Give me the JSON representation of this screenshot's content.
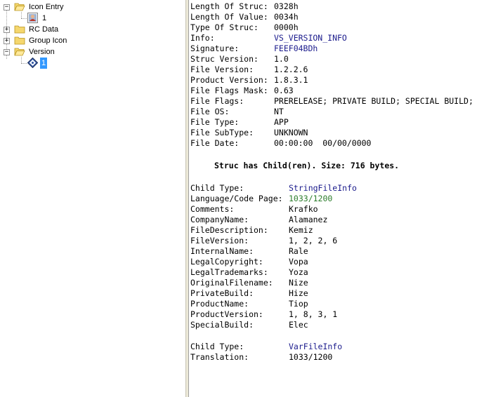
{
  "tree": {
    "items": [
      {
        "label": "Icon Entry",
        "expanded": true
      },
      {
        "label": "1"
      },
      {
        "label": "RC Data",
        "expanded": false
      },
      {
        "label": "Group Icon",
        "expanded": false
      },
      {
        "label": "Version",
        "expanded": true
      },
      {
        "label": "1",
        "selected": true
      }
    ]
  },
  "fixed_info": [
    {
      "key": "Length Of Struc:",
      "value": "0328h"
    },
    {
      "key": "Length Of Value:",
      "value": "0034h"
    },
    {
      "key": "Type Of Struc:",
      "value": "0000h"
    },
    {
      "key": "Info:",
      "value": "VS_VERSION_INFO"
    },
    {
      "key": "Signature:",
      "value": "FEEF04BDh"
    },
    {
      "key": "Struc Version:",
      "value": "1.0"
    },
    {
      "key": "File Version:",
      "value": "1.2.2.6"
    },
    {
      "key": "Product Version:",
      "value": "1.8.3.1"
    },
    {
      "key": "File Flags Mask:",
      "value": "0.63"
    },
    {
      "key": "File Flags:",
      "value": "PRERELEASE; PRIVATE BUILD; SPECIAL BUILD;"
    },
    {
      "key": "File OS:",
      "value": "NT"
    },
    {
      "key": "File Type:",
      "value": "APP"
    },
    {
      "key": "File SubType:",
      "value": "UNKNOWN"
    },
    {
      "key": "File Date:",
      "value": "00:00:00  00/00/0000"
    }
  ],
  "child_note": "Struc has Child(ren). Size: 716 bytes.",
  "string_file_info": {
    "child_type_key": "Child Type:",
    "child_type_value": "StringFileInfo",
    "lang_key": "Language/Code Page:",
    "lang_value": "1033/1200",
    "entries": [
      {
        "key": "Comments:",
        "value": "Krafko"
      },
      {
        "key": "CompanyName:",
        "value": "Alamanez"
      },
      {
        "key": "FileDescription:",
        "value": "Kemiz"
      },
      {
        "key": "FileVersion:",
        "value": "1, 2, 2, 6"
      },
      {
        "key": "InternalName:",
        "value": "Rale"
      },
      {
        "key": "LegalCopyright:",
        "value": "Vopa"
      },
      {
        "key": "LegalTrademarks:",
        "value": "Yoza"
      },
      {
        "key": "OriginalFilename:",
        "value": "Nize"
      },
      {
        "key": "PrivateBuild:",
        "value": "Hize"
      },
      {
        "key": "ProductName:",
        "value": "Tiop"
      },
      {
        "key": "ProductVersion:",
        "value": "1, 8, 3, 1"
      },
      {
        "key": "SpecialBuild:",
        "value": "Elec"
      }
    ]
  },
  "var_file_info": {
    "child_type_key": "Child Type:",
    "child_type_value": "VarFileInfo",
    "translation_key": "Translation:",
    "translation_value": "1033/1200"
  },
  "colors": {
    "selection": "#3399ff",
    "info_value": "#1b1b8c",
    "code_page": "#2c7d2c",
    "folder": "#f5d76e"
  }
}
